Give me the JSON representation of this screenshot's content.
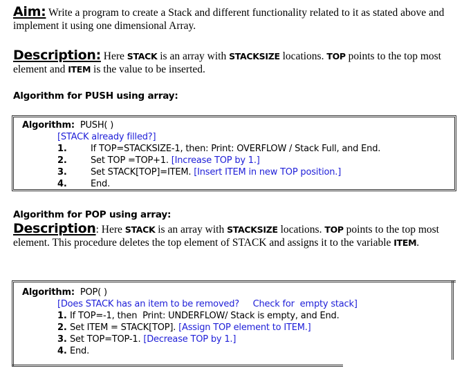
{
  "aim": {
    "heading": "Aim:",
    "text": " Write a program to create a Stack and different functionality related to it as stated above and implement it using one dimensional Array."
  },
  "description1": {
    "heading": "Description:",
    "parts": [
      " Here ",
      "STACK",
      " is an array with ",
      "STACKSIZE",
      " locations. ",
      "TOP",
      " points to the top most element and ",
      "ITEM",
      " is the value to be inserted."
    ]
  },
  "push_section": {
    "heading": "Algorithm for PUSH using array:",
    "box": {
      "label": "Algorithm:",
      "name": "PUSH( )",
      "comment": "[STACK already filled?]",
      "steps": [
        {
          "num": "1.",
          "text": "If TOP=STACKSIZE-1, then: Print: OVERFLOW / Stack Full, and End.",
          "comment": ""
        },
        {
          "num": "2.",
          "text": "Set TOP =TOP+1. ",
          "comment": "[Increase TOP by 1.]"
        },
        {
          "num": "3.",
          "text": "Set STACK[TOP]=ITEM. ",
          "comment": "[Insert ITEM in new TOP position.]"
        },
        {
          "num": "4.",
          "text": "End.",
          "comment": ""
        }
      ]
    }
  },
  "pop_section": {
    "heading": "Algorithm for POP using array:",
    "description": {
      "heading": "Description",
      "parts": [
        ": Here ",
        "STACK",
        " is an array with ",
        "STACKSIZE",
        " locations. ",
        "TOP",
        " points to the top most element. This procedure deletes the top element of STACK and assigns it to the variable ",
        "ITEM",
        "."
      ]
    },
    "box": {
      "label": "Algorithm:",
      "name": "POP( )",
      "comment": "[Does STACK has an item to be removed?     Check for  empty stack]",
      "steps": [
        {
          "num": "1.",
          "text": "If TOP=-1, then  Print: UNDERFLOW/ Stack is empty, and End.",
          "comment": ""
        },
        {
          "num": "2.",
          "text": "Set ITEM = STACK[TOP]. ",
          "comment": "[Assign TOP element to ITEM.]"
        },
        {
          "num": "3.",
          "text": "Set TOP=TOP-1. ",
          "comment": "[Decrease TOP by 1.]"
        },
        {
          "num": "4.",
          "text": "End.",
          "comment": ""
        }
      ]
    }
  },
  "colors": {
    "comment_blue": "#2020d8",
    "text": "#000000"
  }
}
